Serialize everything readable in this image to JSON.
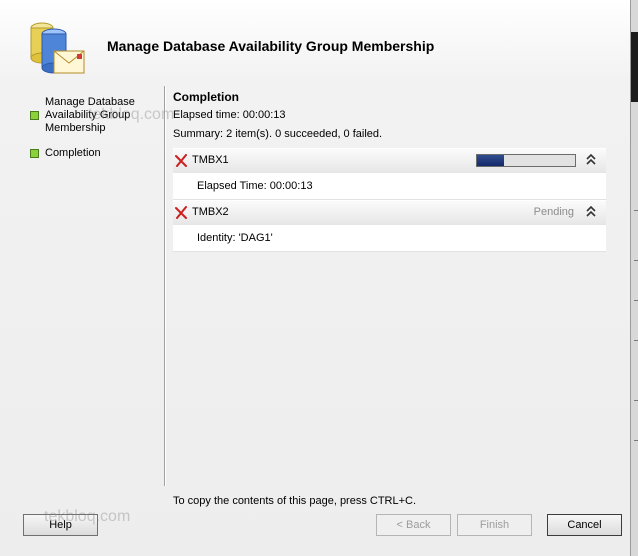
{
  "window": {
    "title": "Manage Database Availability Group Membership",
    "colors": {
      "accent_bar": "#1f3c88",
      "status_bullet": "#8bd13a",
      "error_icon": "#cc1f1f"
    }
  },
  "nav": {
    "items": [
      {
        "label": "Manage Database Availability Group Membership",
        "icon": "green-bullet-icon"
      },
      {
        "label": "Completion",
        "icon": "green-bullet-icon"
      }
    ]
  },
  "main": {
    "section_title": "Completion",
    "elapsed": "Elapsed time: 00:00:13",
    "summary": "Summary: 2 item(s). 0 succeeded, 0 failed.",
    "tasks": [
      {
        "name": "TMBX1",
        "icon": "error-x-icon",
        "progress": 0.28,
        "status": "",
        "detail": "Elapsed Time: 00:00:13"
      },
      {
        "name": "TMBX2",
        "icon": "error-x-icon",
        "status": "Pending",
        "detail": "Identity: 'DAG1'"
      }
    ],
    "copy_hint": "To copy the contents of this page, press CTRL+C."
  },
  "buttons": {
    "help": "Help",
    "back": "< Back",
    "finish": "Finish",
    "cancel": "Cancel"
  },
  "watermark": "tekbloq.com"
}
